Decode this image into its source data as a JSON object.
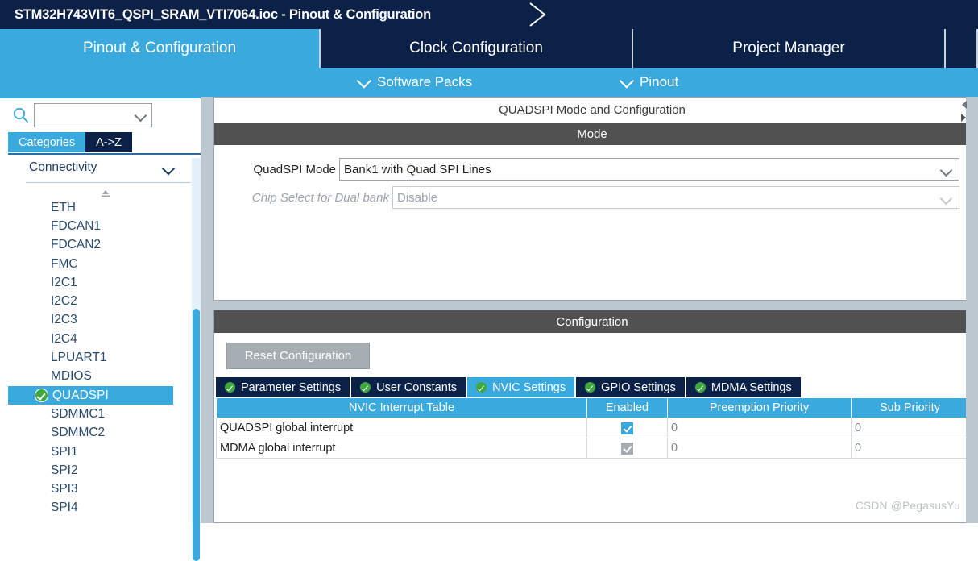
{
  "titlebar": {
    "text": "STM32H743VIT6_QSPI_SRAM_VTI7064.ioc - Pinout & Configuration"
  },
  "main_tabs": [
    {
      "label": "Pinout & Configuration",
      "active": true
    },
    {
      "label": "Clock Configuration",
      "active": false
    },
    {
      "label": "Project Manager",
      "active": false
    }
  ],
  "subbar": {
    "software_packs": "Software Packs",
    "pinout": "Pinout"
  },
  "sidebar": {
    "search": {
      "value": "",
      "placeholder": ""
    },
    "view_tabs": [
      {
        "label": "Categories",
        "selected": true
      },
      {
        "label": "A->Z",
        "selected": false
      }
    ],
    "category": {
      "label": "Connectivity"
    },
    "items": [
      {
        "label": "ETH",
        "selected": false
      },
      {
        "label": "FDCAN1",
        "selected": false
      },
      {
        "label": "FDCAN2",
        "selected": false
      },
      {
        "label": "FMC",
        "selected": false
      },
      {
        "label": "I2C1",
        "selected": false
      },
      {
        "label": "I2C2",
        "selected": false
      },
      {
        "label": "I2C3",
        "selected": false
      },
      {
        "label": "I2C4",
        "selected": false
      },
      {
        "label": "LPUART1",
        "selected": false
      },
      {
        "label": "MDIOS",
        "selected": false
      },
      {
        "label": "QUADSPI",
        "selected": true
      },
      {
        "label": "SDMMC1",
        "selected": false
      },
      {
        "label": "SDMMC2",
        "selected": false
      },
      {
        "label": "SPI1",
        "selected": false
      },
      {
        "label": "SPI2",
        "selected": false
      },
      {
        "label": "SPI3",
        "selected": false
      },
      {
        "label": "SPI4",
        "selected": false
      }
    ]
  },
  "main": {
    "panel_title": "QUADSPI Mode and Configuration",
    "mode": {
      "band": "Mode",
      "quadspi_mode": {
        "label": "QuadSPI Mode",
        "value": "Bank1 with Quad SPI Lines"
      },
      "chip_select": {
        "label": "Chip Select for Dual bank",
        "value": "Disable"
      }
    },
    "configuration": {
      "band": "Configuration",
      "reset_button": "Reset Configuration",
      "tabs": [
        {
          "label": "Parameter Settings",
          "active": false
        },
        {
          "label": "User Constants",
          "active": false
        },
        {
          "label": "NVIC Settings",
          "active": true
        },
        {
          "label": "GPIO Settings",
          "active": false
        },
        {
          "label": "MDMA Settings",
          "active": false
        }
      ],
      "nvic_table": {
        "headers": [
          "NVIC Interrupt Table",
          "Enabled",
          "Preemption Priority",
          "Sub Priority"
        ],
        "rows": [
          {
            "name": "QUADSPI global interrupt",
            "enabled": true,
            "disabled": false,
            "preemption": "0",
            "sub": "0"
          },
          {
            "name": "MDMA global interrupt",
            "enabled": true,
            "disabled": true,
            "preemption": "0",
            "sub": "0"
          }
        ]
      }
    }
  },
  "watermark": "CSDN @PegasusYu",
  "colors": {
    "navy": "#0b2148",
    "accent_blue": "#3aa9dd",
    "band_gray": "#515151",
    "panel_bg": "#bcc7cf",
    "green": "#3fa93f"
  }
}
